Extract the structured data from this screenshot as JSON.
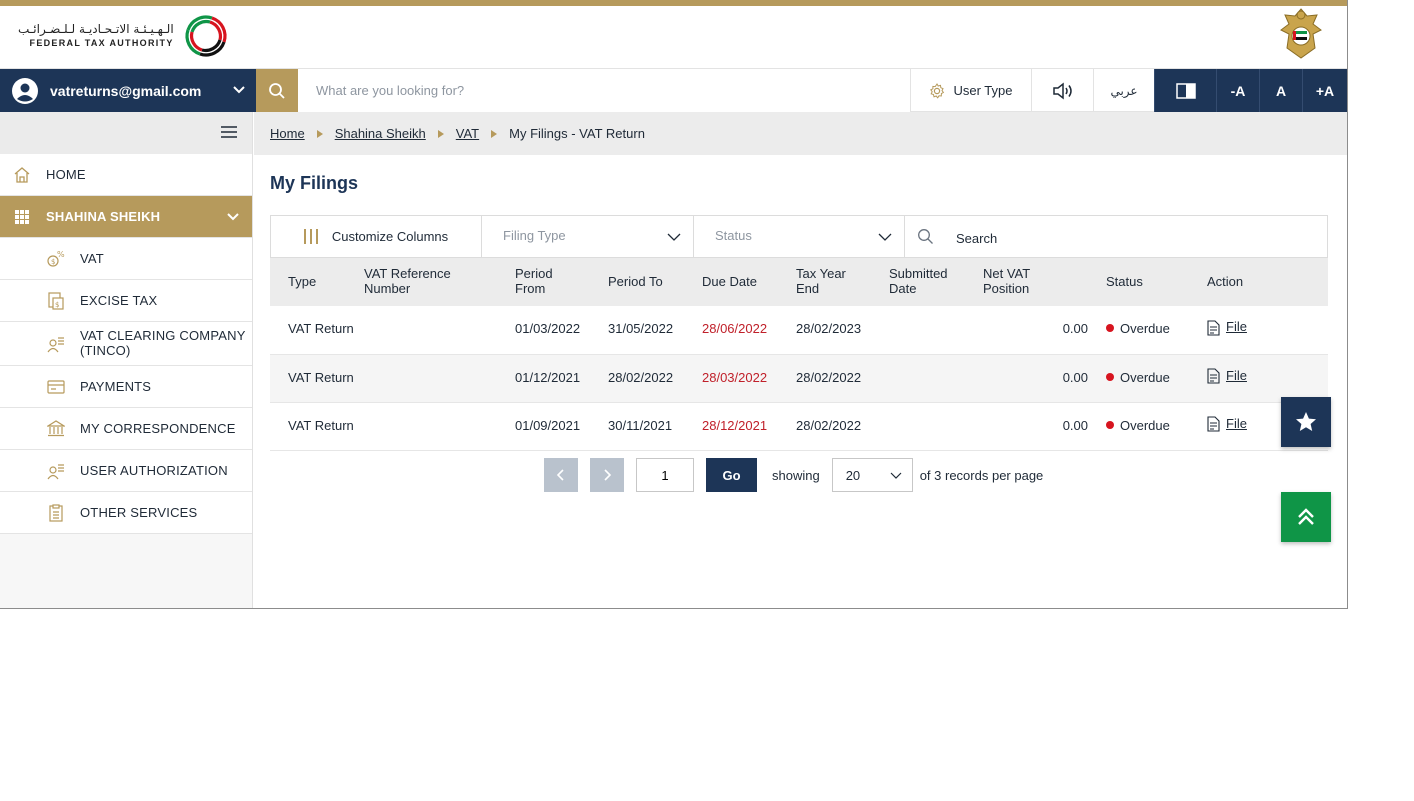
{
  "header": {
    "logo_ar": "الـهـيـئـة الاتـحـاديـة لـلـضـرائـب",
    "logo_en": "FEDERAL TAX AUTHORITY"
  },
  "topbar": {
    "user_email": "vatreturns@gmail.com",
    "search_placeholder": "What are you looking for?",
    "user_type_label": "User Type",
    "arabic_label": "عربي",
    "font_minus": "-A",
    "font_normal": "A",
    "font_plus": "+A"
  },
  "sidebar": {
    "items": [
      {
        "label": "HOME",
        "icon": "home-icon"
      },
      {
        "label": "SHAHINA SHEIKH",
        "icon": "grid-icon"
      },
      {
        "label": "VAT",
        "icon": "vat-money-icon"
      },
      {
        "label": "EXCISE TAX",
        "icon": "excise-doc-icon"
      },
      {
        "label": "VAT CLEARING COMPANY",
        "label2": "(TINCO)",
        "icon": "users-list-icon"
      },
      {
        "label": "PAYMENTS",
        "icon": "card-icon"
      },
      {
        "label": "MY CORRESPONDENCE",
        "icon": "bank-building-icon"
      },
      {
        "label": "USER AUTHORIZATION",
        "icon": "users-list-icon"
      },
      {
        "label": "OTHER SERVICES",
        "icon": "clipboard-icon"
      }
    ]
  },
  "breadcrumb": {
    "home": "Home",
    "person": "Shahina Sheikh",
    "vat": "VAT",
    "current": "My Filings - VAT Return"
  },
  "page": {
    "title": "My Filings"
  },
  "filters": {
    "customize_label": "Customize Columns",
    "filing_type_placeholder": "Filing Type",
    "status_placeholder": "Status",
    "search_placeholder": "Search"
  },
  "table": {
    "headers": {
      "type": "Type",
      "ref_1": "VAT Reference",
      "ref_2": "Number",
      "from_1": "Period",
      "from_2": "From",
      "to": "Period To",
      "due": "Due Date",
      "end_1": "Tax Year",
      "end_2": "End",
      "sub_1": "Submitted",
      "sub_2": "Date",
      "net_1": "Net VAT",
      "net_2": "Position",
      "status": "Status",
      "action": "Action"
    },
    "rows": [
      {
        "type": "VAT Return",
        "ref": "",
        "from": "01/03/2022",
        "to": "31/05/2022",
        "due": "28/06/2022",
        "end": "28/02/2023",
        "submitted": "",
        "net": "0.00",
        "status": "Overdue",
        "action": "File"
      },
      {
        "type": "VAT Return",
        "ref": "",
        "from": "01/12/2021",
        "to": "28/02/2022",
        "due": "28/03/2022",
        "end": "28/02/2022",
        "submitted": "",
        "net": "0.00",
        "status": "Overdue",
        "action": "File"
      },
      {
        "type": "VAT Return",
        "ref": "",
        "from": "01/09/2021",
        "to": "30/11/2021",
        "due": "28/12/2021",
        "end": "28/02/2022",
        "submitted": "",
        "net": "0.00",
        "status": "Overdue",
        "action": "File"
      }
    ]
  },
  "pagination": {
    "page": "1",
    "go_label": "Go",
    "showing_label": "showing",
    "per_page": "20",
    "records_label": "of 3 records per page"
  },
  "colors": {
    "navy": "#1d3557",
    "gold": "#b69a5c",
    "overdue_red": "#c0202a",
    "green": "#0f9547"
  }
}
